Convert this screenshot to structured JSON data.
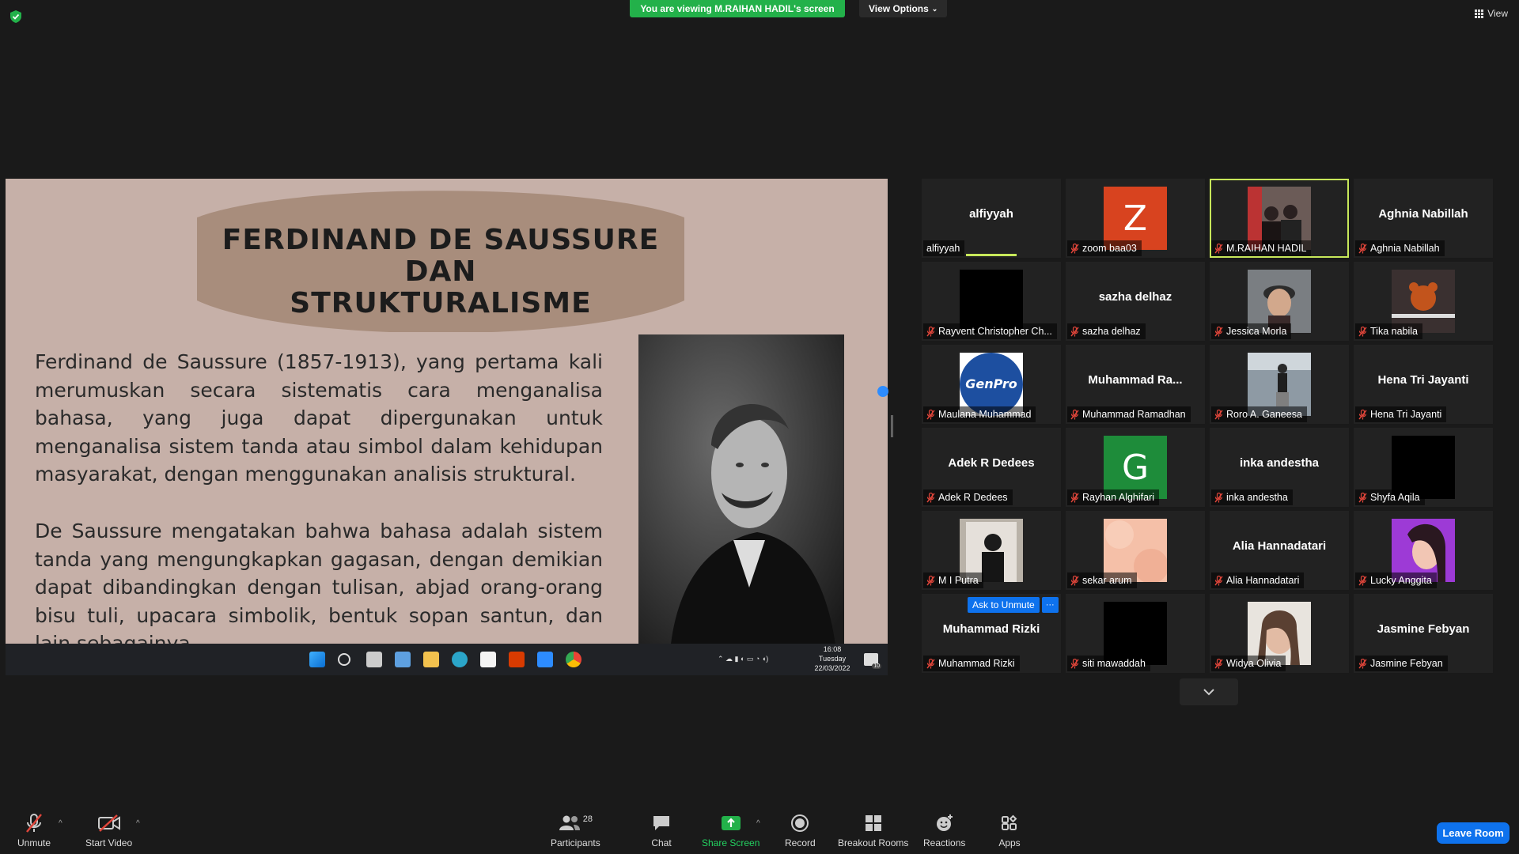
{
  "meeting": {
    "viewing_banner": "You are viewing M.RAIHAN HADIL's screen",
    "view_options_label": "View Options",
    "view_label": "View"
  },
  "slide": {
    "title_line1": "FERDINAND DE SAUSSURE DAN",
    "title_line2": "STRUKTURALISME",
    "paragraph1": "Ferdinand de Saussure (1857-1913), yang pertama kali merumuskan secara sistematis cara menganalisa bahasa, yang juga dapat dipergunakan untuk menganalisa sistem tanda atau simbol dalam kehidupan masyarakat, dengan menggunakan analisis struktural.",
    "paragraph2": "De Saussure mengatakan bahwa bahasa adalah sistem tanda yang mengungkapkan gagasan, dengan demikian dapat dibandingkan dengan tulisan, abjad orang-orang bisu tuli, upacara simbolik, bentuk sopan santun, dan lain sebagainya.",
    "colors": {
      "background": "#c6b0a8",
      "banner": "#a88d7c",
      "text": "#2a2a2a"
    }
  },
  "windows_taskbar": {
    "time": "16:08",
    "day": "Tuesday",
    "date": "22/03/2022",
    "notif_count": "10"
  },
  "participants": [
    {
      "name": "alfiyyah",
      "display": "alfiyyah",
      "type": "name",
      "muted": false,
      "speaking": true
    },
    {
      "name": "zoom baa03",
      "type": "letter",
      "letter": "Z",
      "color": "#d8431f",
      "muted": true
    },
    {
      "name": "M.RAIHAN HADIL",
      "type": "photo",
      "photo": "people",
      "muted": true,
      "active": true
    },
    {
      "name": "Aghnia Nabillah",
      "display": "Aghnia Nabillah",
      "type": "name",
      "muted": true
    },
    {
      "name": "Rayvent Christopher Ch...",
      "type": "photo",
      "photo": "black",
      "muted": true
    },
    {
      "name": "sazha delhaz",
      "display": "sazha delhaz",
      "type": "name",
      "muted": true
    },
    {
      "name": "Jessica Morla",
      "type": "photo",
      "photo": "doll",
      "muted": true
    },
    {
      "name": "Tika nabila",
      "type": "photo",
      "photo": "bear",
      "muted": true
    },
    {
      "name": "Maulana Muhammad",
      "type": "photo",
      "photo": "genpro",
      "photo_text": "GenPro",
      "muted": true
    },
    {
      "name": "Muhammad Ramadhan",
      "display": "Muhammad  Ra...",
      "type": "name",
      "muted": true
    },
    {
      "name": "Roro A. Ganeesa",
      "type": "photo",
      "photo": "street",
      "muted": true
    },
    {
      "name": "Hena Tri Jayanti",
      "display": "Hena Tri Jayanti",
      "type": "name",
      "muted": true
    },
    {
      "name": "Adek R Dedees",
      "display": "Adek R Dedees",
      "type": "name",
      "muted": true
    },
    {
      "name": "Rayhan Alghifari",
      "type": "letter",
      "letter": "G",
      "color": "#1e8c3a",
      "muted": true
    },
    {
      "name": "inka andestha",
      "display": "inka andestha",
      "type": "name",
      "muted": true
    },
    {
      "name": "Shyfa Aqila",
      "type": "photo",
      "photo": "black",
      "muted": true
    },
    {
      "name": "M I Putra",
      "type": "photo",
      "photo": "mirror",
      "muted": true
    },
    {
      "name": "sekar arum",
      "type": "photo",
      "photo": "peach",
      "muted": true
    },
    {
      "name": "Alia Hannadatari",
      "display": "Alia Hannadatari",
      "type": "name",
      "muted": true
    },
    {
      "name": "Lucky Anggita",
      "type": "photo",
      "photo": "selfie-purple",
      "muted": true
    },
    {
      "name": "Muhammad Rizki",
      "display": "Muhammad Rizki",
      "type": "name",
      "muted": true,
      "hover": true
    },
    {
      "name": "siti mawaddah",
      "type": "photo",
      "photo": "black",
      "muted": true
    },
    {
      "name": "Widya Olivia",
      "type": "photo",
      "photo": "selfie",
      "muted": true
    },
    {
      "name": "Jasmine Febyan",
      "display": "Jasmine Febyan",
      "type": "name",
      "muted": true
    }
  ],
  "hover_actions": {
    "ask_to_unmute": "Ask to Unmute",
    "more": "···"
  },
  "controls": {
    "unmute": "Unmute",
    "start_video": "Start Video",
    "participants": "Participants",
    "participants_count": "28",
    "chat": "Chat",
    "share_screen": "Share Screen",
    "record": "Record",
    "breakout_rooms": "Breakout Rooms",
    "reactions": "Reactions",
    "apps": "Apps",
    "leave_room": "Leave Room"
  },
  "accent_colors": {
    "green": "#23b14a",
    "blue": "#0e72ed",
    "active_border": "#c7e85a",
    "muted_red": "#e0453a"
  }
}
